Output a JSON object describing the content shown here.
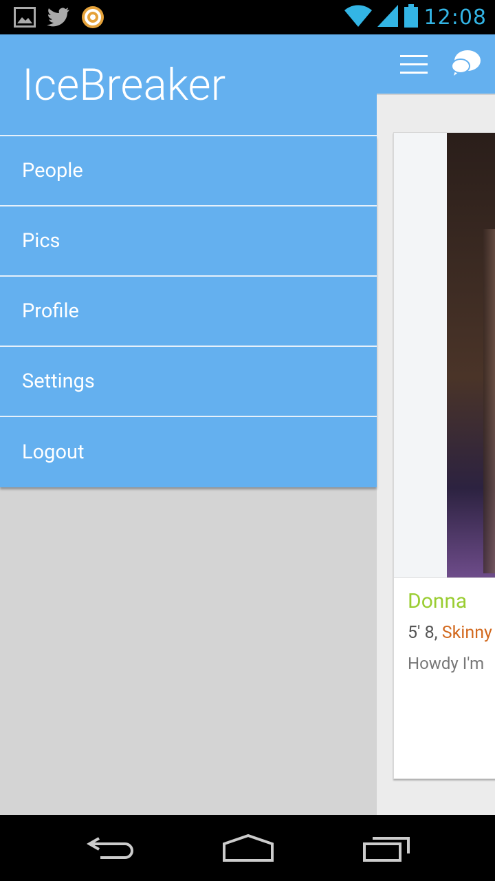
{
  "status_bar": {
    "time": "12:08",
    "left_icons": [
      "gallery-icon",
      "twitter-icon",
      "notification-app-icon"
    ],
    "right_icons": [
      "wifi-icon",
      "signal-icon",
      "battery-icon"
    ]
  },
  "drawer": {
    "app_title": "IceBreaker",
    "items": [
      {
        "label": "People"
      },
      {
        "label": "Pics"
      },
      {
        "label": "Profile"
      },
      {
        "label": "Settings"
      },
      {
        "label": "Logout"
      }
    ]
  },
  "action_bar": {
    "icons": [
      "menu-icon",
      "chat-icon"
    ]
  },
  "card": {
    "name": "Donna",
    "stats_height": "5' 8, ",
    "stats_build": "Skinny",
    "bio": "Howdy I'm"
  },
  "nav_bar": {
    "icons": [
      "back-icon",
      "home-icon",
      "recents-icon"
    ]
  },
  "colors": {
    "primary": "#64b0ef",
    "name": "#9acd32",
    "accent": "#d2691e",
    "clock": "#33b5e5"
  }
}
